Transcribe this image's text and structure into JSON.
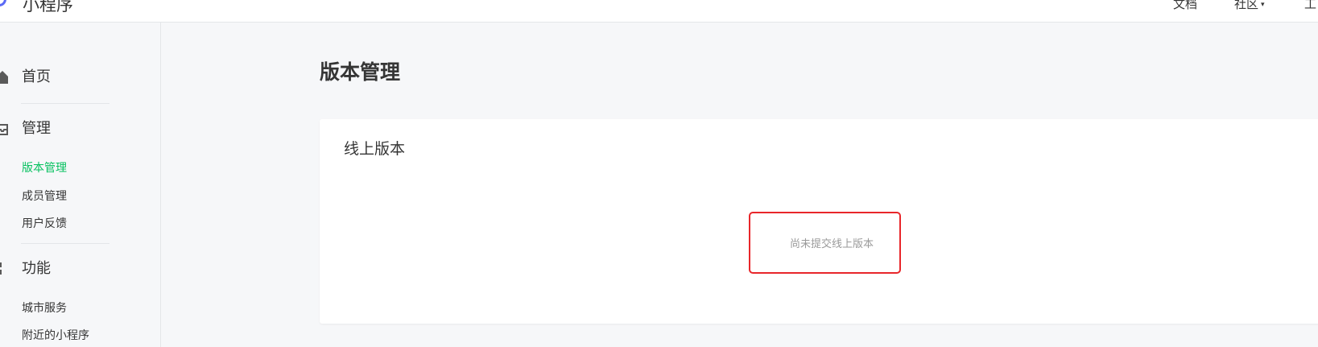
{
  "topbar": {
    "brand_name": "小程序",
    "nav": {
      "docs": "文档",
      "community": "社区",
      "community_caret": "▾",
      "more": "工"
    }
  },
  "sidebar": {
    "home": {
      "label": "首页",
      "icon": "home-icon"
    },
    "manage": {
      "label": "管理",
      "icon": "inbox-icon",
      "items": [
        {
          "label": "版本管理",
          "active": true
        },
        {
          "label": "成员管理",
          "active": false
        },
        {
          "label": "用户反馈",
          "active": false
        }
      ]
    },
    "features": {
      "label": "功能",
      "icon": "grid-icon",
      "items": [
        {
          "label": "城市服务"
        },
        {
          "label": "附近的小程序"
        }
      ]
    }
  },
  "main": {
    "page_title": "版本管理",
    "online_version_card": {
      "title": "线上版本",
      "empty_text": "尚未提交线上版本"
    }
  },
  "colors": {
    "active_green": "#07c160",
    "highlight_red": "#e8262a",
    "brand_blue": "#5b6af5",
    "page_bg": "#f6f7f9"
  }
}
